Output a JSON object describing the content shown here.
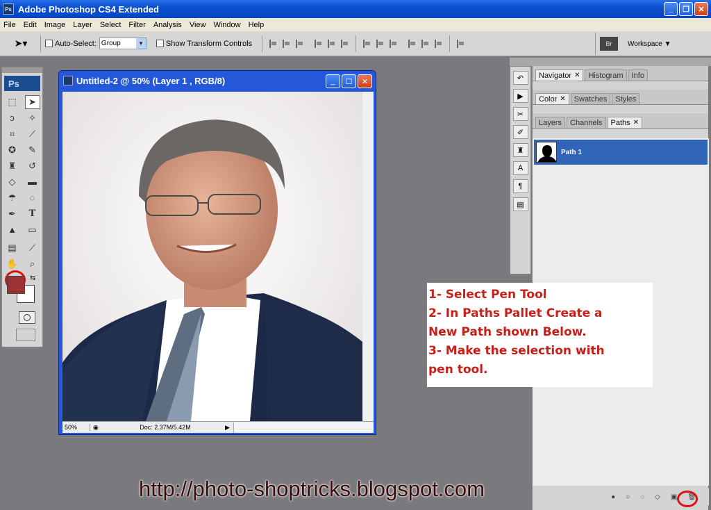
{
  "window": {
    "title": "Adobe Photoshop CS4 Extended",
    "app_icon": "Ps"
  },
  "menu": [
    "File",
    "Edit",
    "Image",
    "Layer",
    "Select",
    "Filter",
    "Analysis",
    "View",
    "Window",
    "Help"
  ],
  "options": {
    "auto_select_label": "Auto-Select:",
    "auto_select_value": "Group",
    "transform_label": "Show Transform Controls",
    "workspace_label": "Workspace ▼",
    "bridge_icon": "Br"
  },
  "toolbox": {
    "logo": "Ps",
    "fg_color": "#9b3335",
    "bg_color": "#ffffff"
  },
  "document": {
    "title": "Untitled-2 @ 50% (Layer 1 , RGB/8)",
    "zoom": "50%",
    "doc_info": "Doc: 2.37M/5.42M"
  },
  "panels": {
    "group1": [
      "Navigator",
      "Histogram",
      "Info"
    ],
    "group2": [
      "Color",
      "Swatches",
      "Styles"
    ],
    "group3": [
      "Layers",
      "Channels",
      "Paths"
    ],
    "path_name": "Path 1"
  },
  "note": {
    "line1": "1-  Select Pen Tool",
    "line2": "2-  In Paths Pallet Create a",
    "line3": "New Path shown Below.",
    "line4": "3-  Make the selection with",
    "line5": "pen tool."
  },
  "watermark": "http://photo-shoptricks.blogspot.com",
  "colors": {
    "accent": "#2558d9",
    "annotation": "#d11111"
  }
}
